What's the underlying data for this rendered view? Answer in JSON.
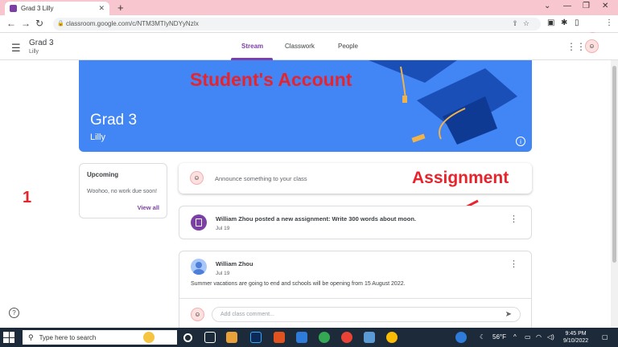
{
  "browser": {
    "tab_title": "Grad 3 Lilly",
    "tab_close": "✕",
    "new_tab": "+",
    "url": "classroom.google.com/c/NTM3MTIyNDYyNzIx"
  },
  "header": {
    "class_name": "Grad 3",
    "section": "Lilly",
    "tabs": [
      "Stream",
      "Classwork",
      "People"
    ],
    "active_tab": "Stream"
  },
  "banner": {
    "title": "Grad 3",
    "subtitle": "Lilly",
    "info_glyph": "i"
  },
  "annotations": {
    "overlay_title": "Student's Account",
    "assignment_label": "Assignment",
    "side_number": "1"
  },
  "upcoming": {
    "heading": "Upcoming",
    "text": "Woohoo, no work due soon!",
    "view_all": "View all"
  },
  "announce": {
    "placeholder": "Announce something to your class"
  },
  "posts": [
    {
      "text": "William Zhou posted a new assignment: Write 300 words about moon.",
      "date": "Jul 19"
    },
    {
      "author": "William Zhou",
      "date": "Jul 19",
      "message": "Summer vacations are going to end and schools will be opening from 15 August 2022.",
      "comment_placeholder": "Add class comment..."
    }
  ],
  "taskbar": {
    "search_placeholder": "Type here to search",
    "weather": "56°F",
    "time": "9:45 PM",
    "date": "9/10/2022"
  },
  "colors": {
    "accent": "#7b3fa6",
    "banner": "#4285f4",
    "annotation_red": "#e8232c"
  }
}
